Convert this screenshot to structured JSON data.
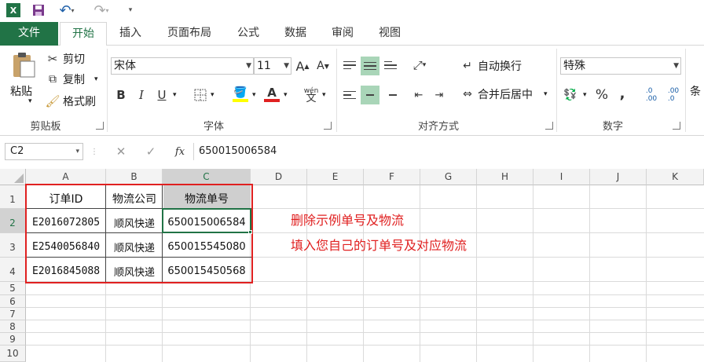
{
  "window": {
    "quick_access": [
      "excel-icon",
      "save-icon",
      "undo-icon",
      "redo-icon",
      "customize-icon"
    ]
  },
  "tabs": [
    "文件",
    "开始",
    "插入",
    "页面布局",
    "公式",
    "数据",
    "审阅",
    "视图"
  ],
  "ribbon": {
    "clipboard": {
      "paste": "粘贴",
      "cut": "剪切",
      "copy": "复制",
      "format_painter": "格式刷",
      "label": "剪贴板"
    },
    "font": {
      "name": "宋体",
      "size": "11",
      "bold": "B",
      "italic": "I",
      "underline": "U",
      "label": "字体",
      "phonetic": "wén",
      "phonetic_char": "文"
    },
    "alignment": {
      "wrap_text": "自动换行",
      "merge_center": "合并后居中",
      "label": "对齐方式"
    },
    "number": {
      "format": "特殊",
      "percent": "%",
      "comma": ",",
      "label": "数字",
      "inc_decimal": ".0\n.00",
      "dec_decimal": ".00\n.0"
    },
    "styles": {
      "label": "条"
    }
  },
  "formula_bar": {
    "cell_ref": "C2",
    "fx": "fx",
    "value": "650015006584"
  },
  "columns": [
    "A",
    "B",
    "C",
    "D",
    "E",
    "F",
    "G",
    "H",
    "I",
    "J",
    "K"
  ],
  "rows": [
    "1",
    "2",
    "3",
    "4",
    "5",
    "6",
    "7",
    "8",
    "9",
    "10"
  ],
  "table": {
    "headers": [
      "订单ID",
      "物流公司",
      "物流单号"
    ],
    "rows": [
      [
        "E2016072805",
        "顺风快递",
        "650015006584"
      ],
      [
        "E2540056840",
        "顺风快递",
        "650015545080"
      ],
      [
        "E2016845088",
        "顺风快递",
        "650015450568"
      ]
    ]
  },
  "notes": [
    "删除示例单号及物流",
    "填入您自己的订单号及对应物流"
  ],
  "colors": {
    "excel_green": "#217346",
    "selected_col": "#d2d2d2",
    "red": "#e02020"
  }
}
